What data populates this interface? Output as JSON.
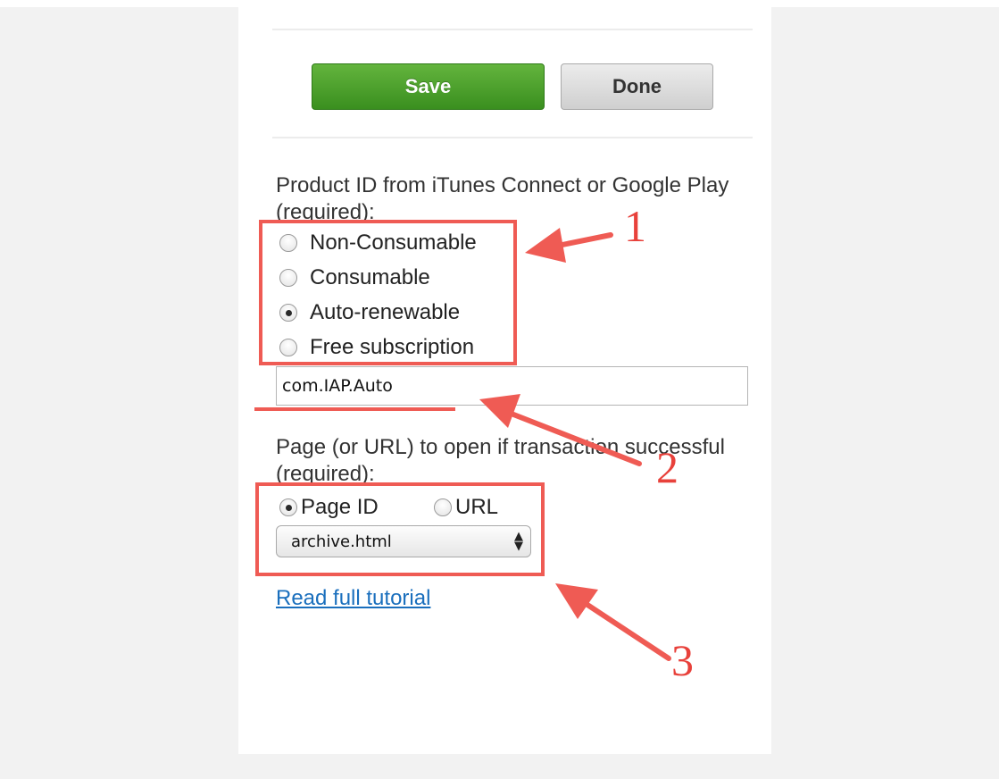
{
  "buttons": {
    "save_label": "Save",
    "done_label": "Done"
  },
  "product_section": {
    "label": "Product ID from iTunes Connect or Google Play (required):",
    "options": [
      {
        "label": "Non-Consumable",
        "checked": false
      },
      {
        "label": "Consumable",
        "checked": false
      },
      {
        "label": "Auto-renewable",
        "checked": true
      },
      {
        "label": "Free subscription",
        "checked": false
      }
    ],
    "product_id_value": "com.IAP.Auto"
  },
  "page_section": {
    "label": "Page (or URL) to open if transaction successful (required):",
    "page_id_label": "Page ID",
    "url_label": "URL",
    "selected": "page-id",
    "select_value": "archive.html"
  },
  "tutorial_link": "Read full tutorial",
  "annotations": {
    "n1": "1",
    "n2": "2",
    "n3": "3"
  },
  "colors": {
    "annotation": "#ef5b54",
    "save_button": "#4aa32b",
    "link": "#1a6fbd"
  }
}
